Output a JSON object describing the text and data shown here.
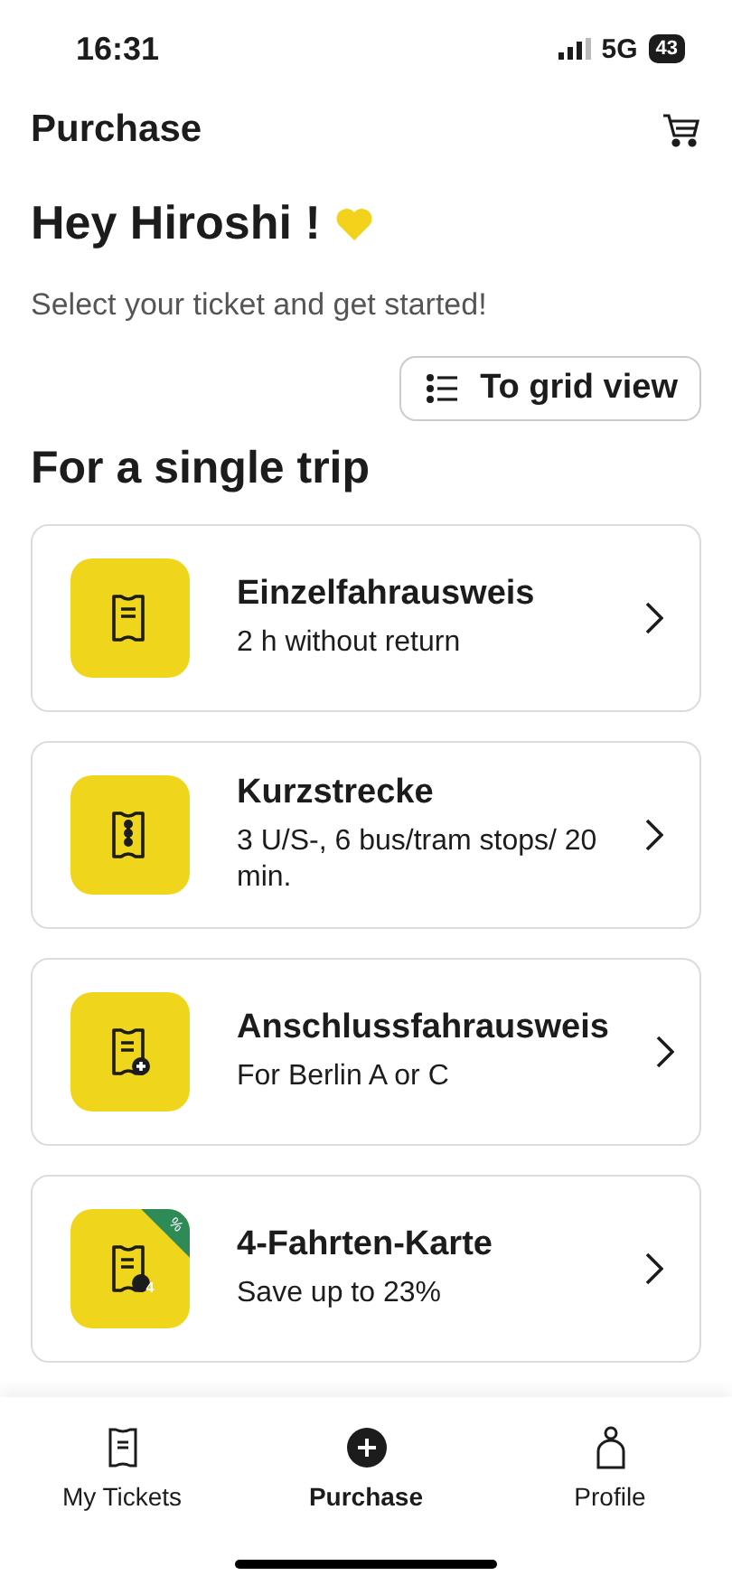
{
  "status_bar": {
    "time": "16:31",
    "network": "5G",
    "battery": "43"
  },
  "header": {
    "title": "Purchase"
  },
  "greeting": "Hey Hiroshi !",
  "subtitle": "Select your ticket and get started!",
  "view_toggle": {
    "label": "To grid view"
  },
  "section_title": "For a single trip",
  "tickets": [
    {
      "kind": "single",
      "title": "Einzelfahrausweis",
      "subtitle": "2 h without return"
    },
    {
      "kind": "short",
      "title": "Kurzstrecke",
      "subtitle": "3 U/S-, 6 bus/tram stops/ 20 min."
    },
    {
      "kind": "connection",
      "title": "Anschlussfahrausweis",
      "subtitle": "For Berlin A or C"
    },
    {
      "kind": "multi",
      "title": "4-Fahrten-Karte",
      "subtitle": "Save up to 23%",
      "icon_number": "4",
      "badge": "%"
    }
  ],
  "tab_bar": [
    {
      "kind": "tickets",
      "label": "My Tickets",
      "selected": false
    },
    {
      "kind": "purchase",
      "label": "Purchase",
      "selected": true
    },
    {
      "kind": "profile",
      "label": "Profile",
      "selected": false
    }
  ]
}
